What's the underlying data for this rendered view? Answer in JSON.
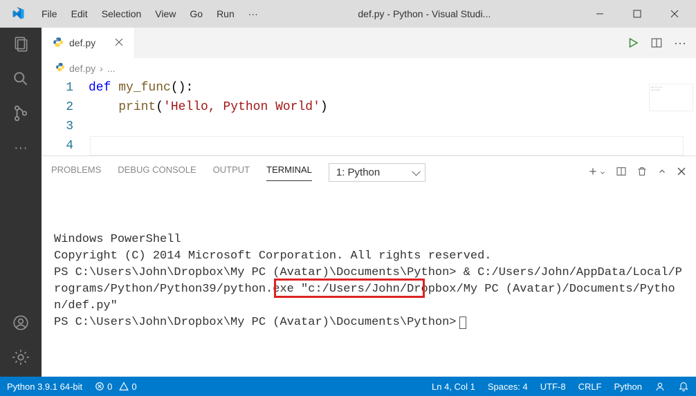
{
  "titleBar": {
    "menus": [
      "File",
      "Edit",
      "Selection",
      "View",
      "Go",
      "Run",
      "···"
    ],
    "title": "def.py - Python - Visual Studi..."
  },
  "tabs": {
    "activeFile": "def.py",
    "breadcrumb": "def.py",
    "breadcrumbTrail": "..."
  },
  "editor": {
    "lines": [
      {
        "n": "1",
        "html": "<span class='kw'>def</span><span class='plain'> </span><span class='fn'>my_func</span><span class='plain'>():</span>"
      },
      {
        "n": "2",
        "html": "<span class='plain'>    </span><span class='fn'>print</span><span class='plain'>(</span><span class='str'>'Hello, Python World'</span><span class='plain'>)</span>"
      },
      {
        "n": "3",
        "html": ""
      },
      {
        "n": "4",
        "html": ""
      }
    ]
  },
  "panel": {
    "tabs": [
      "PROBLEMS",
      "DEBUG CONSOLE",
      "OUTPUT",
      "TERMINAL"
    ],
    "activeTab": "TERMINAL",
    "dropdown": "1: Python",
    "terminalLines": [
      "Windows PowerShell",
      "Copyright (C) 2014 Microsoft Corporation. All rights reserved.",
      "",
      "PS C:\\Users\\John\\Dropbox\\My PC (Avatar)\\Documents\\Python> & C:/Users/John/AppData/Local/Programs/Python/Python39/python.exe \"c:/Users/John/Dropbox/My PC (Avatar)/Documents/Python/def.py\"",
      "PS C:\\Users\\John\\Dropbox\\My PC (Avatar)\\Documents\\Python>"
    ]
  },
  "statusBar": {
    "python": "Python 3.9.1 64-bit",
    "errors": "0",
    "warnings": "0",
    "lnCol": "Ln 4, Col 1",
    "spaces": "Spaces: 4",
    "encoding": "UTF-8",
    "eol": "CRLF",
    "lang": "Python"
  }
}
